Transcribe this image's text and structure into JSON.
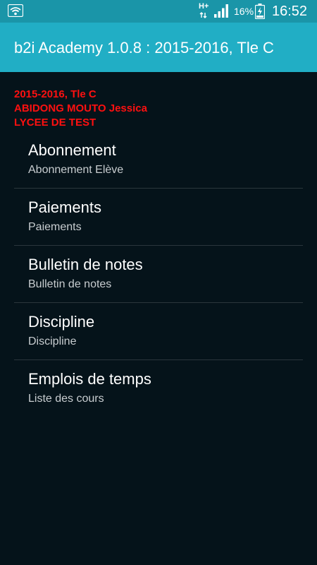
{
  "status_bar": {
    "network_type": "H+",
    "battery_percent": "16%",
    "time": "16:52",
    "icons": [
      "wifi-icon",
      "network-arrows-icon",
      "signal-icon",
      "battery-charging-icon"
    ]
  },
  "app_bar": {
    "title": "b2i Academy 1.0.8 : 2015-2016, Tle C",
    "color": "#21aec5"
  },
  "student": {
    "class_line": "2015-2016, Tle C",
    "name": "ABIDONG MOUTO Jessica",
    "school": "LYCEE DE TEST",
    "color": "#ff1010"
  },
  "menu": {
    "items": [
      {
        "title": "Abonnement",
        "subtitle": "Abonnement Elève"
      },
      {
        "title": "Paiements",
        "subtitle": "Paiements"
      },
      {
        "title": "Bulletin de notes",
        "subtitle": "Bulletin de notes"
      },
      {
        "title": "Discipline",
        "subtitle": "Discipline"
      },
      {
        "title": "Emplois de temps",
        "subtitle": "Liste des cours"
      }
    ]
  }
}
